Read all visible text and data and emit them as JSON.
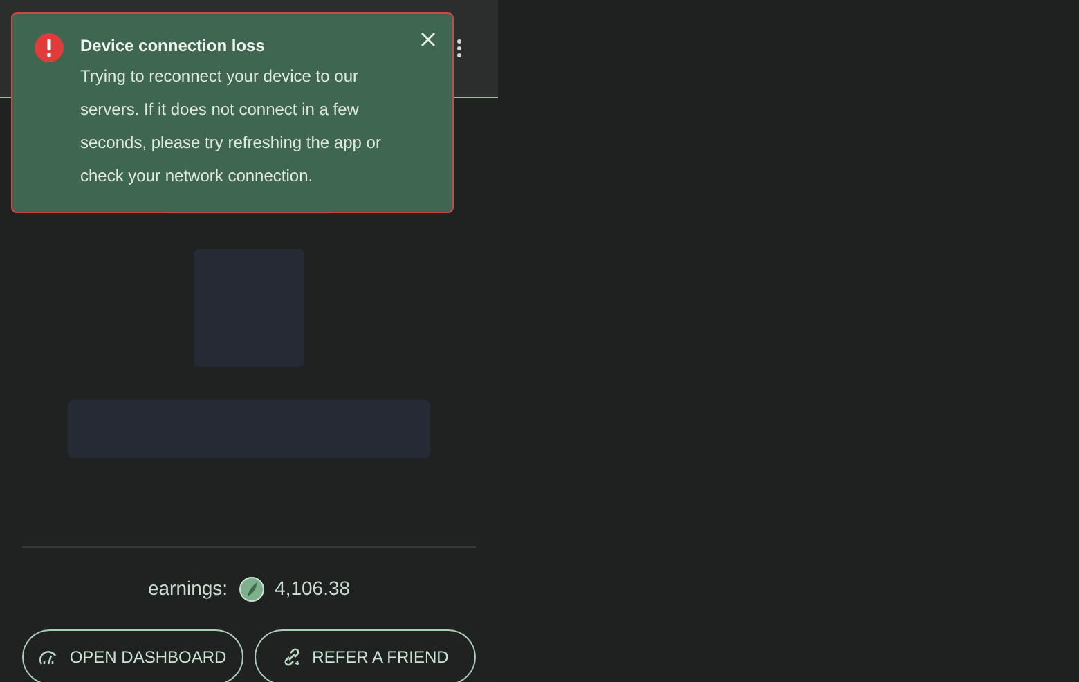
{
  "toast": {
    "title": "Device connection loss",
    "message": "Trying to reconnect your device to our servers. If it does not connect in a few seconds, please try refreshing the app or check your network connection."
  },
  "earnings": {
    "label": "earnings:",
    "value": "4,106.38"
  },
  "buttons": [
    {
      "label": "OPEN DASHBOARD",
      "kind": "dashboard"
    },
    {
      "label": "REFER A FRIEND",
      "kind": "refer"
    }
  ]
}
